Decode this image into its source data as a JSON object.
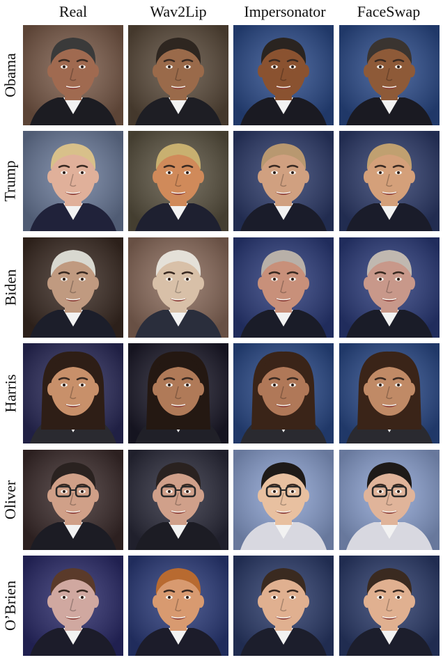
{
  "columns": [
    "Real",
    "Wav2Lip",
    "Impersonator",
    "FaceSwap"
  ],
  "rows": [
    {
      "label": "Obama",
      "cells": [
        {
          "bg": "#7a5a48",
          "skin": "#a06a50",
          "hair": "#3a3a3a",
          "shirt": "#1c1c22"
        },
        {
          "bg": "#5a4a3a",
          "skin": "#9a6a4a",
          "hair": "#2e2620",
          "shirt": "#1e1e24"
        },
        {
          "bg": "#2a4a8a",
          "skin": "#8a5230",
          "hair": "#2a2420",
          "shirt": "#1a1a22"
        },
        {
          "bg": "#2a4a8a",
          "skin": "#8e5a38",
          "hair": "#3a3430",
          "shirt": "#1a1a22"
        }
      ]
    },
    {
      "label": "Trump",
      "cells": [
        {
          "bg": "#6a7a9a",
          "skin": "#e0b09a",
          "hair": "#d8c08a",
          "shirt": "#20223a"
        },
        {
          "bg": "#5a5240",
          "skin": "#d08a5a",
          "hair": "#c8b070",
          "shirt": "#1e2030"
        },
        {
          "bg": "#2c3a6a",
          "skin": "#d0a080",
          "hair": "#b89870",
          "shirt": "#1a1c2a"
        },
        {
          "bg": "#2c3a6a",
          "skin": "#d4a07a",
          "hair": "#c0a070",
          "shirt": "#1a1c2a"
        }
      ]
    },
    {
      "label": "Biden",
      "cells": [
        {
          "bg": "#3a2a22",
          "skin": "#c09a80",
          "hair": "#d8d8d0",
          "shirt": "#1c1e2a"
        },
        {
          "bg": "#8a6a5a",
          "skin": "#d8c0a8",
          "hair": "#e4e0d8",
          "shirt": "#2a2e3c"
        },
        {
          "bg": "#2a3a7a",
          "skin": "#c8907a",
          "hair": "#b8b0a8",
          "shirt": "#1a1c28"
        },
        {
          "bg": "#2a3a7a",
          "skin": "#c8988a",
          "hair": "#c0b8b0",
          "shirt": "#1a1c28"
        }
      ]
    },
    {
      "label": "Harris",
      "cells": [
        {
          "bg": "#2a2a5a",
          "skin": "#c8906a",
          "hair": "#2e1e16",
          "shirt": "#2a2a30"
        },
        {
          "bg": "#1c1a2a",
          "skin": "#b07a58",
          "hair": "#241812",
          "shirt": "#202028"
        },
        {
          "bg": "#2a4a8a",
          "skin": "#b07858",
          "hair": "#3a2418",
          "shirt": "#2a2a30"
        },
        {
          "bg": "#2a4a8a",
          "skin": "#c08a66",
          "hair": "#3a2418",
          "shirt": "#2a2a30"
        }
      ]
    },
    {
      "label": "Oliver",
      "cells": [
        {
          "bg": "#3a2a2a",
          "skin": "#d0a088",
          "hair": "#2a2220",
          "shirt": "#1c1c24"
        },
        {
          "bg": "#2a2a3a",
          "skin": "#d0a08a",
          "hair": "#2a2220",
          "shirt": "#1c1c24"
        },
        {
          "bg": "#8aa0d0",
          "skin": "#e8c0a0",
          "hair": "#1e1a18",
          "shirt": "#d8d8e0"
        },
        {
          "bg": "#8aa0d0",
          "skin": "#e0b49a",
          "hair": "#1e1a18",
          "shirt": "#d8d8e0"
        }
      ]
    },
    {
      "label": "O’Brien",
      "cells": [
        {
          "bg": "#2a2a6a",
          "skin": "#d0a8a0",
          "hair": "#5a3a2a",
          "shirt": "#1c1c2a"
        },
        {
          "bg": "#2a3a7a",
          "skin": "#d89a70",
          "hair": "#b86a30",
          "shirt": "#1c1c2a"
        },
        {
          "bg": "#2a3a6a",
          "skin": "#e0b090",
          "hair": "#3a2a20",
          "shirt": "#1c1e2c"
        },
        {
          "bg": "#2a3a6a",
          "skin": "#e0b090",
          "hair": "#3a2a20",
          "shirt": "#1c1e2c"
        }
      ]
    }
  ]
}
